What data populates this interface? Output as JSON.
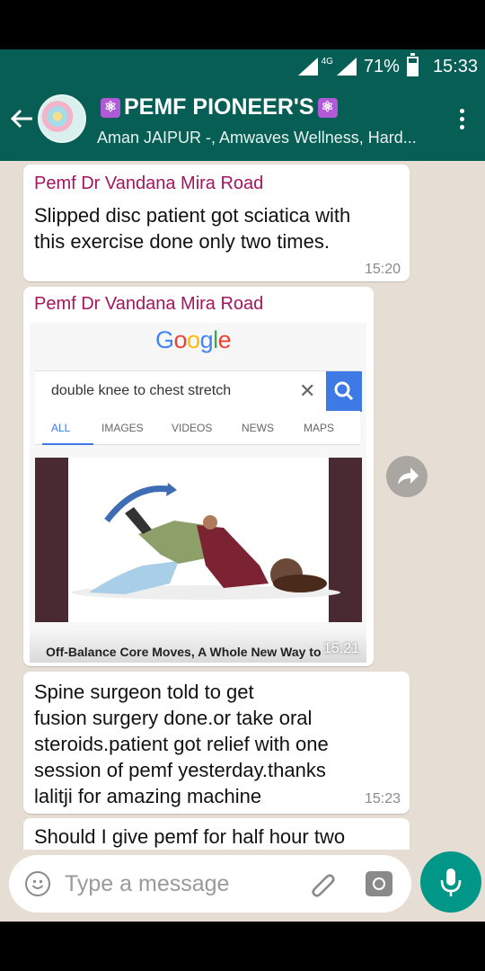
{
  "status_bar": {
    "network": "4G",
    "battery": "71%",
    "time": "15:33"
  },
  "header": {
    "group_name": "PEMF PIONEER'S",
    "members": "Aman JAIPUR -, Amwaves Wellness, Hard..."
  },
  "google": {
    "logo": "Google",
    "query": "double knee to chest stretch",
    "tabs": [
      "ALL",
      "IMAGES",
      "VIDEOS",
      "NEWS",
      "MAPS"
    ],
    "result_caption": "Off-Balance Core Moves, A Whole New Way to"
  },
  "messages": [
    {
      "sender": "Pemf Dr Vandana Mira Road",
      "text_lines": [
        "Slipped disc patient got sciatica with",
        "this exercise done only two times."
      ],
      "time": "15:20"
    },
    {
      "sender": "Pemf Dr Vandana Mira Road",
      "type": "image",
      "time": "15:21"
    },
    {
      "text_lines": [
        "Spine surgeon told to get",
        "fusion surgery done.or take oral",
        "steroids.patient got relief with one",
        "session of pemf yesterday.thanks",
        "lalitji for amazing machine"
      ],
      "time": "15:23"
    },
    {
      "text_lines": [
        "Should I give pemf for half hour two"
      ]
    }
  ],
  "composer": {
    "placeholder": "Type a message"
  },
  "colors": {
    "header": "#075e54",
    "sender": "#a3165f",
    "mic_button": "#009688",
    "chat_bg": "#e6ddd4"
  }
}
